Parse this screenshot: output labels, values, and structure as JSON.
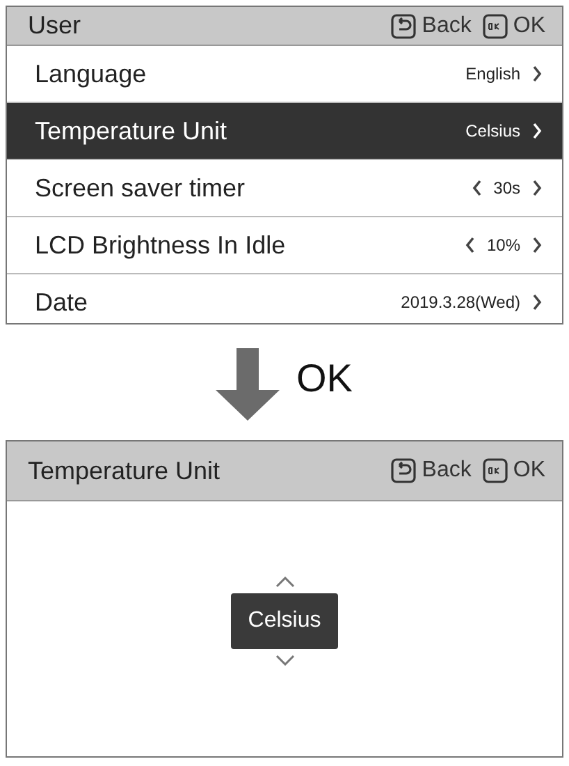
{
  "menu_screen": {
    "title": "User",
    "header_buttons": [
      {
        "kind": "back",
        "label": "Back"
      },
      {
        "kind": "ok",
        "label": "OK"
      }
    ],
    "rows": [
      {
        "label": "Language",
        "value": "English",
        "kind": "link",
        "selected": false
      },
      {
        "label": "Temperature Unit",
        "value": "Celsius",
        "kind": "link",
        "selected": true
      },
      {
        "label": "Screen saver timer",
        "value": "30s",
        "kind": "spinner",
        "selected": false
      },
      {
        "label": "LCD Brightness In Idle",
        "value": "10%",
        "kind": "spinner",
        "selected": false
      },
      {
        "label": "Date",
        "value": "2019.3.28(Wed)",
        "kind": "link",
        "selected": false
      }
    ]
  },
  "transition": {
    "label": "OK"
  },
  "detail_screen": {
    "title": "Temperature Unit",
    "header_buttons": [
      {
        "kind": "back",
        "label": "Back"
      },
      {
        "kind": "ok",
        "label": "OK"
      }
    ],
    "value": "Celsius"
  }
}
